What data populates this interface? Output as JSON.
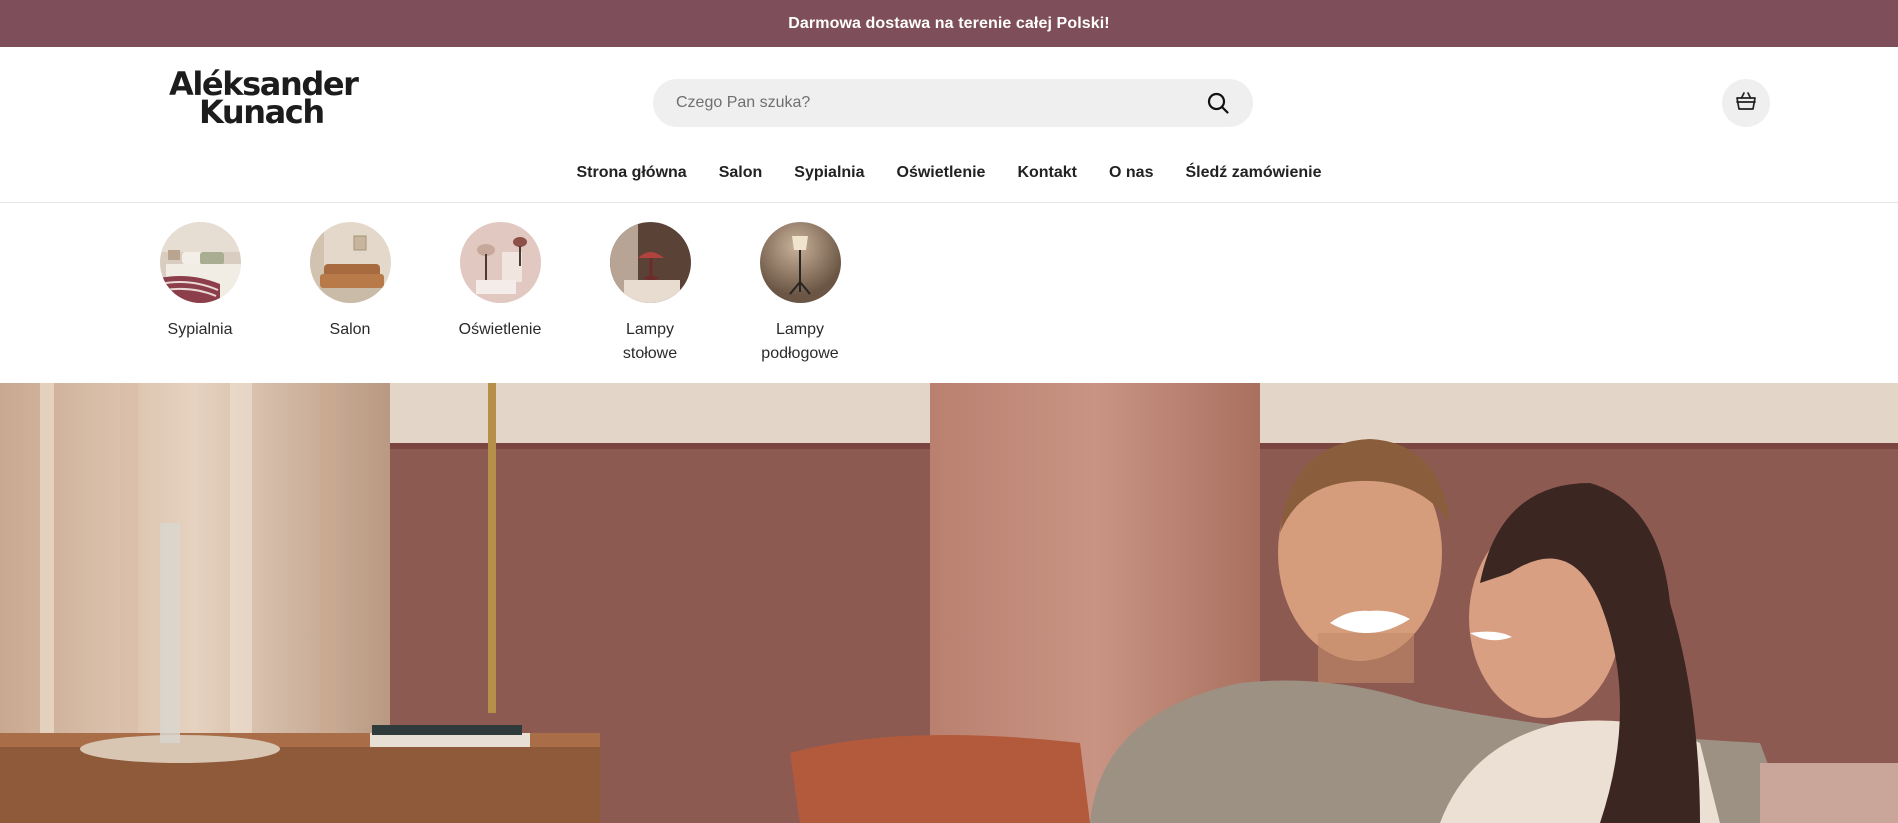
{
  "announcement": {
    "text": "Darmowa dostawa na terenie całej Polski!"
  },
  "logo": {
    "line1": "Aléksander",
    "line2": "Kunach"
  },
  "search": {
    "placeholder": "Czego Pan szuka?"
  },
  "icons": {
    "search": "search-icon",
    "cart": "shopping-bag-icon"
  },
  "nav": {
    "items": [
      {
        "label": "Strona główna"
      },
      {
        "label": "Salon"
      },
      {
        "label": "Sypialnia"
      },
      {
        "label": "Oświetlenie"
      },
      {
        "label": "Kontakt"
      },
      {
        "label": "O nas"
      },
      {
        "label": "Śledź zamówienie"
      }
    ]
  },
  "categories": [
    {
      "label": "Sypialnia"
    },
    {
      "label": "Salon"
    },
    {
      "label": "Oświetlenie"
    },
    {
      "label": "Lampy stołowe"
    },
    {
      "label": "Lampy podłogowe"
    }
  ],
  "colors": {
    "announcement_bg": "#7e4e5a",
    "search_bg": "#efefef",
    "hero_wall": "#8a5a52"
  }
}
